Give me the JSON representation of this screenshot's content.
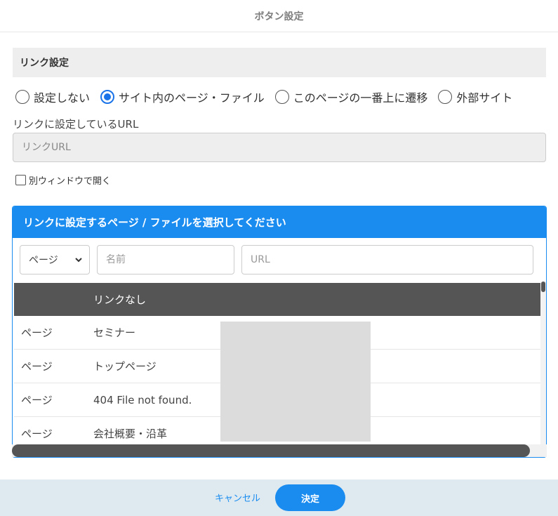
{
  "dialog": {
    "title": "ボタン設定"
  },
  "link_settings": {
    "section_title": "リンク設定",
    "options": [
      {
        "label": "設定しない",
        "checked": false
      },
      {
        "label": "サイト内のページ・ファイル",
        "checked": true
      },
      {
        "label": "このページの一番上に遷移",
        "checked": false
      },
      {
        "label": "外部サイト",
        "checked": false
      }
    ],
    "url_label": "リンクに設定しているURL",
    "url_placeholder": "リンクURL",
    "url_value": "",
    "new_window_label": "別ウィンドウで開く",
    "new_window_checked": false
  },
  "picker": {
    "title": "リンクに設定するページ / ファイルを選択してください",
    "type_select": "ページ",
    "name_placeholder": "名前",
    "url_placeholder": "URL",
    "header_row": {
      "type": "",
      "name": "リンクなし"
    },
    "rows": [
      {
        "type": "ページ",
        "name": "セミナー"
      },
      {
        "type": "ページ",
        "name": "トップページ"
      },
      {
        "type": "ページ",
        "name": "404 File not found."
      },
      {
        "type": "ページ",
        "name": "会社概要・沿革"
      }
    ]
  },
  "footer": {
    "cancel_label": "キャンセル",
    "ok_label": "決定"
  },
  "colors": {
    "accent": "#1a8cf0",
    "header_row_bg": "#555555",
    "footer_bg": "#deeaf0"
  },
  "icons": {
    "select_chevron": "chevron-down-icon"
  }
}
